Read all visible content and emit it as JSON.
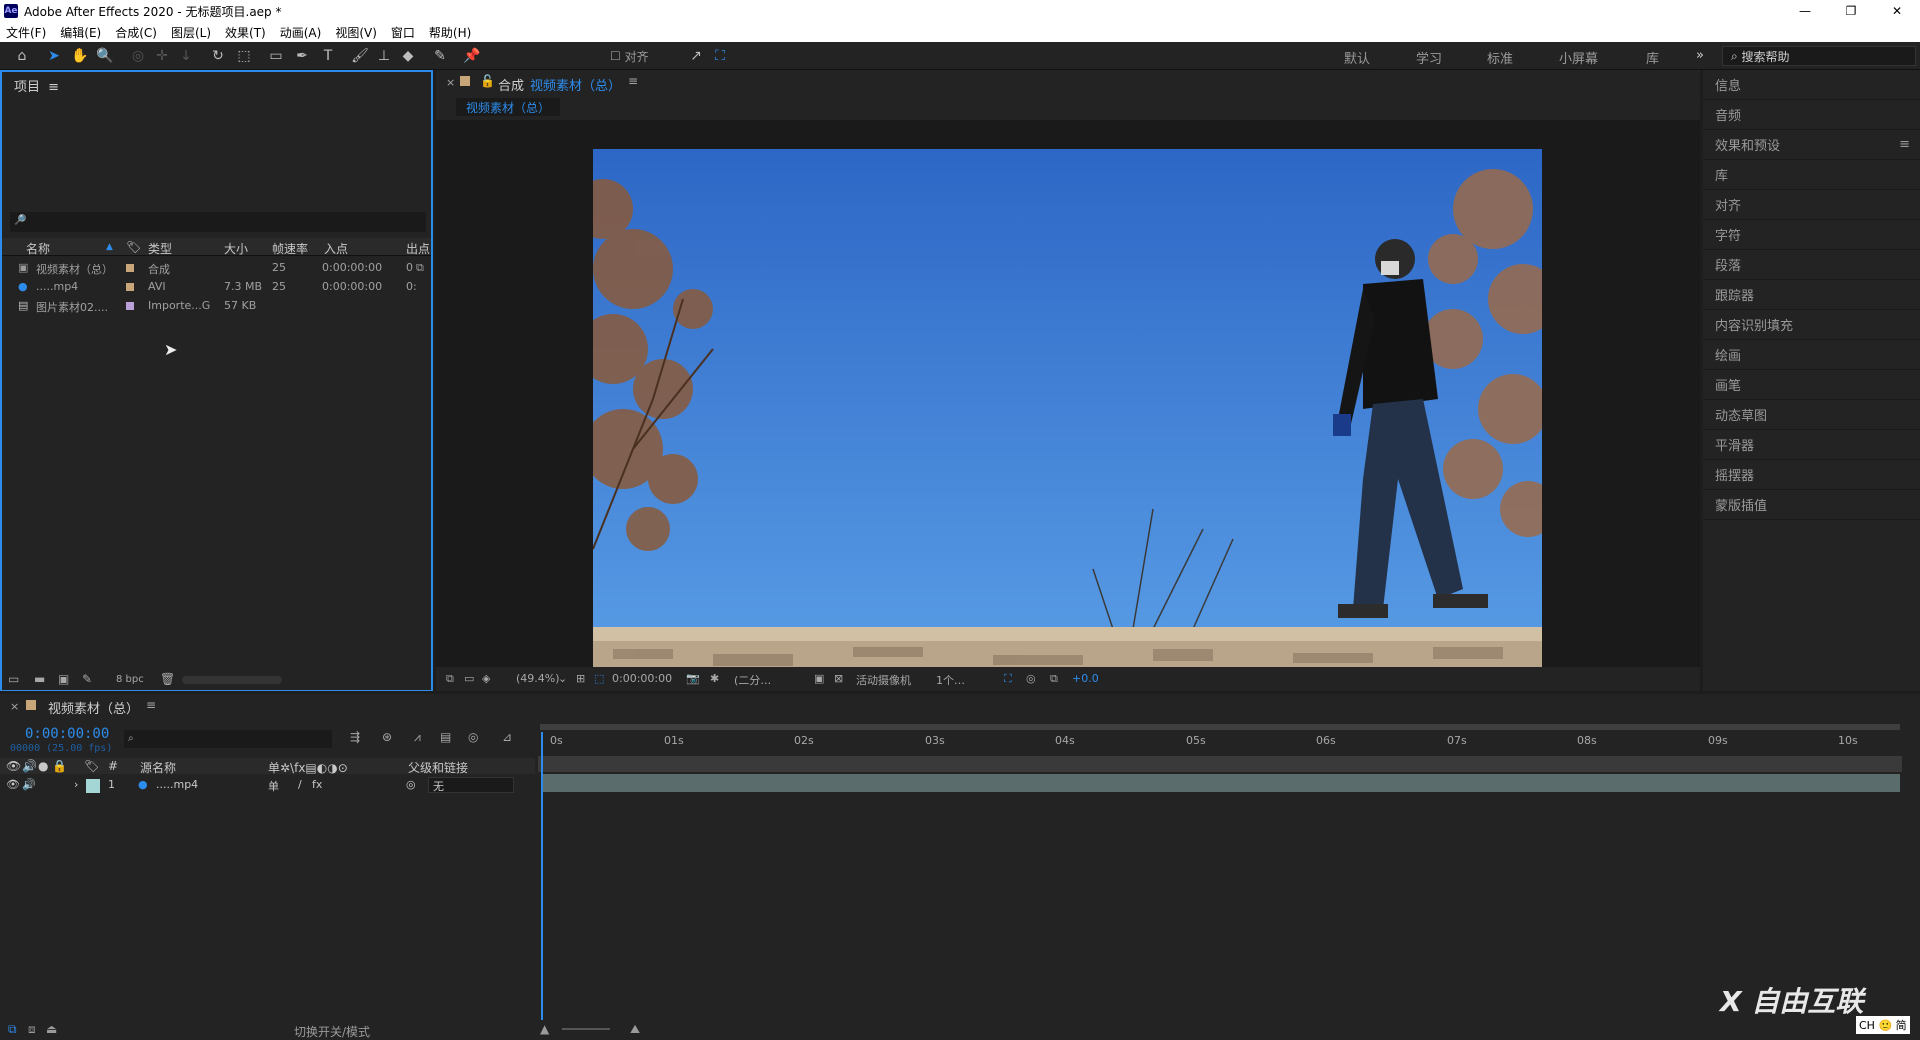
{
  "window": {
    "title": "Adobe After Effects 2020 - 无标题项目.aep *",
    "logo": "Ae",
    "controls": [
      "—",
      "❐",
      "✕"
    ]
  },
  "menu": [
    "文件(F)",
    "编辑(E)",
    "合成(C)",
    "图层(L)",
    "效果(T)",
    "动画(A)",
    "视图(V)",
    "窗口",
    "帮助(H)"
  ],
  "toolbar": {
    "align_label": "对齐",
    "workspaces": [
      "默认",
      "学习",
      "标准",
      "小屏幕",
      "库"
    ],
    "more": "»",
    "search_help": "搜索帮助"
  },
  "project": {
    "title": "项目",
    "menu_icon": "≡",
    "search_icon": "🔎",
    "columns": [
      "名称",
      "类型",
      "大小",
      "帧速率",
      "入点",
      "出点"
    ],
    "items": [
      {
        "name": "视频素材（总）",
        "type": "合成",
        "size": "",
        "fps": "25",
        "in": "0:00:00:00",
        "out": "0",
        "color": "#c9a57a"
      },
      {
        "name": ".....mp4",
        "type": "AVI",
        "size": "7.3 MB",
        "fps": "25",
        "in": "0:00:00:00",
        "out": "0:",
        "color": "#c9a57a"
      },
      {
        "name": "图片素材02....",
        "type": "Importe...G",
        "size": "57 KB",
        "fps": "",
        "in": "",
        "out": "",
        "color": "#b9a0d6"
      }
    ],
    "bpc": "8 bpc"
  },
  "composition": {
    "close": "×",
    "label": "合成",
    "name": "视频素材（总）",
    "tab": "视频素材（总）",
    "zoom": "(49.4%)",
    "timecode": "0:00:00:00",
    "resolution": "(二分…",
    "camera": "活动摄像机",
    "views": "1个…",
    "exposure": "+0.0"
  },
  "right_panel": {
    "items": [
      "信息",
      "音频",
      "效果和预设",
      "库",
      "对齐",
      "字符",
      "段落",
      "跟踪器",
      "内容识别填充",
      "绘画",
      "画笔",
      "动态草图",
      "平滑器",
      "摇摆器",
      "蒙版插值"
    ]
  },
  "timeline": {
    "comp_name": "视频素材（总）",
    "timecode": "0:00:00:00",
    "fps_line": "00000 (25.00 fps)",
    "columns": {
      "num": "#",
      "source": "源名称",
      "parent": "父级和链接"
    },
    "layer": {
      "index": "1",
      "name": ".....mp4",
      "parent": "无"
    },
    "ruler": [
      "0s",
      "01s",
      "02s",
      "03s",
      "04s",
      "05s",
      "06s",
      "07s",
      "08s",
      "09s",
      "10s"
    ],
    "footer": "切换开关/模式"
  },
  "watermark": "X 自由互联",
  "ime": "CH 🙂 简"
}
